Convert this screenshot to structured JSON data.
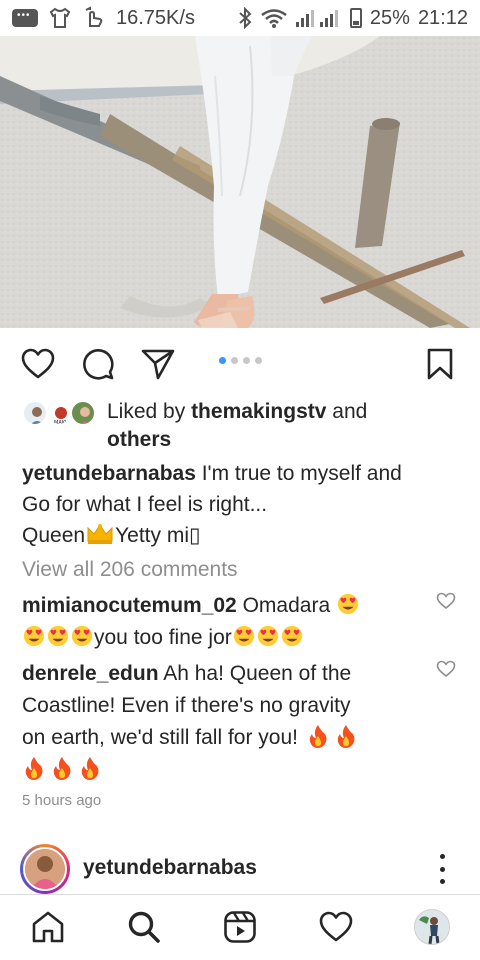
{
  "status_bar": {
    "speed": "16.75K/s",
    "battery": "25%",
    "time": "21:12",
    "icons": [
      "chat-bubble-icon",
      "tshirt-icon",
      "hand-icon",
      "bluetooth-icon",
      "wifi-icon",
      "signal-icon",
      "battery-icon"
    ]
  },
  "post": {
    "carousel": {
      "count": 4,
      "active_index": 0
    },
    "likes": {
      "prefix": "Liked by ",
      "user": "themakingstv",
      "connector": " and",
      "others": "others"
    },
    "caption": {
      "username": "yetundebarnabas",
      "line1": " I'm true to myself and",
      "line2": "Go for what I feel is right...",
      "line3a": "Queen",
      "line3b": "Yetty mi",
      "trailing_glyph": "▯"
    },
    "view_comments": "View all 206 comments",
    "comments": [
      {
        "username": "mimianocutemum_02",
        "text": " Omadara ",
        "text2": "you too fine jor"
      },
      {
        "username": "denrele_edun",
        "line1": " Ah ha! Queen of the",
        "line2": "Coastline! Even if there's no gravity",
        "line3": "on earth, we'd still fall for you! "
      }
    ],
    "timestamp": "5 hours ago"
  },
  "next_post": {
    "username": "yetundebarnabas"
  },
  "colors": {
    "accent": "#3897f0",
    "text": "#262626",
    "muted": "#8e8e8e",
    "divider": "#dbdbdb"
  },
  "bottom_nav": [
    "home-icon",
    "search-icon",
    "reels-icon",
    "activity-heart-icon",
    "profile-avatar"
  ]
}
